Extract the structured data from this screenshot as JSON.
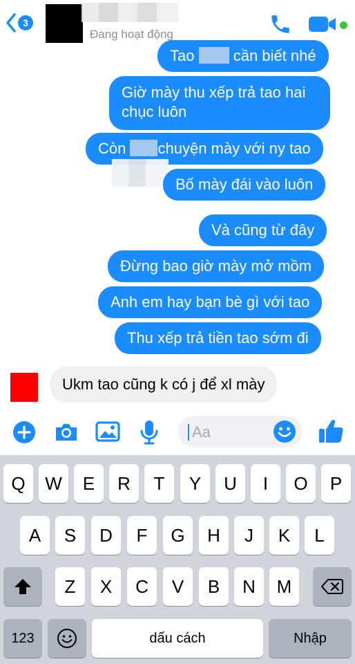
{
  "header": {
    "unread_count": "3",
    "status": "Đang hoạt động",
    "accent": "#1a8cff",
    "online_color": "#3cc23c"
  },
  "messages": [
    {
      "from": "me",
      "parts": [
        "Tao ",
        " cần biết nhé"
      ]
    },
    {
      "from": "me",
      "text": "Giờ mày thu xếp trả tao hai chục luôn"
    },
    {
      "from": "me",
      "parts": [
        "Còn ",
        "chuyện mày với ny tao"
      ]
    },
    {
      "from": "me",
      "text": "Bố mày đái vào luôn"
    },
    {
      "from": "me",
      "text": "Và cũng từ đây"
    },
    {
      "from": "me",
      "text": "Đừng bao giờ mày mở mồm"
    },
    {
      "from": "me",
      "text": "Anh em hay bạn bè gì với tao"
    },
    {
      "from": "me",
      "text": "Thu xếp trả tiền tao sớm đi"
    },
    {
      "from": "them",
      "text": "Ukm tao cũng k có j để xl mày"
    }
  ],
  "composer": {
    "placeholder": "Aa",
    "icons": [
      "plus-icon",
      "camera-icon",
      "gallery-icon",
      "microphone-icon",
      "emoji-icon",
      "thumbs-up-icon"
    ]
  },
  "keyboard": {
    "row1": [
      "Q",
      "W",
      "E",
      "R",
      "T",
      "Y",
      "U",
      "I",
      "O",
      "P"
    ],
    "row2": [
      "A",
      "S",
      "D",
      "F",
      "G",
      "H",
      "J",
      "K",
      "L"
    ],
    "row3": [
      "Z",
      "X",
      "C",
      "V",
      "B",
      "N",
      "M"
    ],
    "numbers_label": "123",
    "space_label": "dấu cách",
    "return_label": "Nhập"
  }
}
